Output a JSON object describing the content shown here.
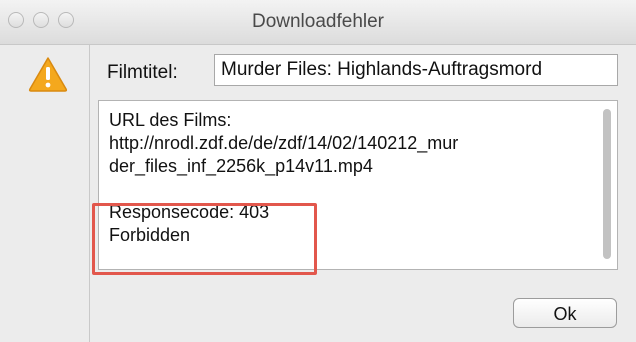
{
  "window": {
    "title": "Downloadfehler"
  },
  "form": {
    "filmtitel_label": "Filmtitel:",
    "filmtitel_value": "Murder Files: Highlands-Auftragsmord"
  },
  "message": {
    "line1": "URL des Films:",
    "line2": "http://nrodl.zdf.de/de/zdf/14/02/140212_mur",
    "line3": "der_files_inf_2256k_p14v11.mp4",
    "line4": "Responsecode: 403",
    "line5": "Forbidden"
  },
  "buttons": {
    "ok_label": "Ok"
  },
  "icons": {
    "warning": "warning-icon"
  },
  "colors": {
    "highlight": "#e2574c",
    "warning_fill": "#f4a81d"
  }
}
